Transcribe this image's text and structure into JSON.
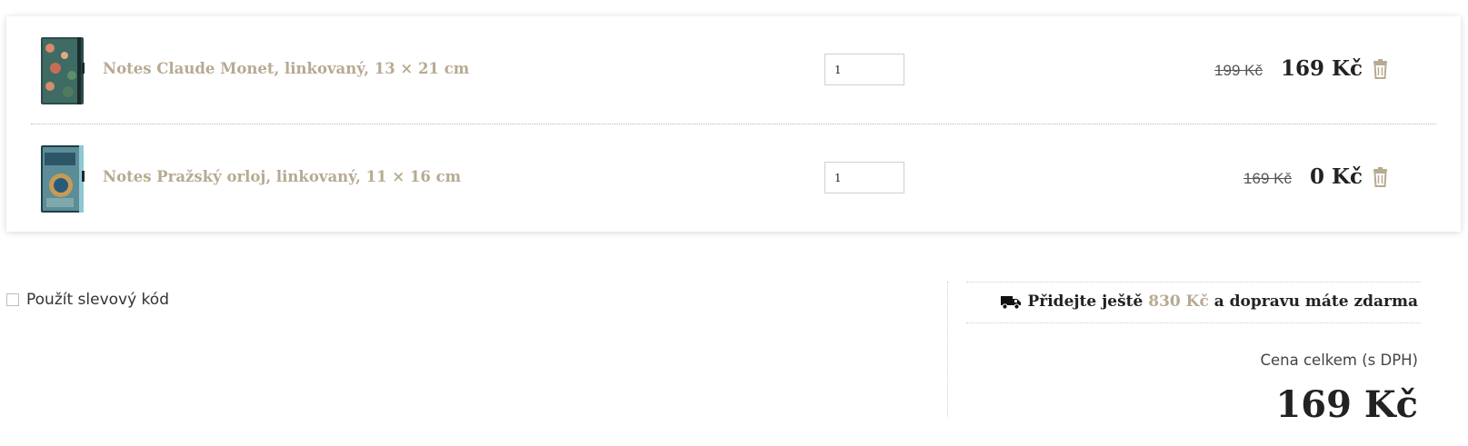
{
  "cart": {
    "items": [
      {
        "thumbnail_icon": "notebook-monet-thumbnail",
        "name": "Notes Claude Monet, linkovaný, 13 × 21 cm",
        "quantity": "1",
        "old_price": "199 Kč",
        "price": "169 Kč",
        "delete_icon": "trash-icon"
      },
      {
        "thumbnail_icon": "notebook-prague-thumbnail",
        "name": "Notes Pražský orloj, linkovaný, 11 × 16 cm",
        "quantity": "1",
        "old_price": "169 Kč",
        "price": "0 Kč",
        "delete_icon": "trash-icon"
      }
    ]
  },
  "discount": {
    "checked": false,
    "label": "Použít slevový kód"
  },
  "shipping": {
    "icon": "truck-icon",
    "text_before": "Přidejte ještě",
    "amount": "830 Kč",
    "text_after": "a dopravu máte zdarma"
  },
  "summary": {
    "total_label": "Cena celkem (s DPH)",
    "total_price": "169 Kč"
  },
  "colors": {
    "accent": "#b7aa92",
    "text": "#222222",
    "muted": "#555555"
  }
}
